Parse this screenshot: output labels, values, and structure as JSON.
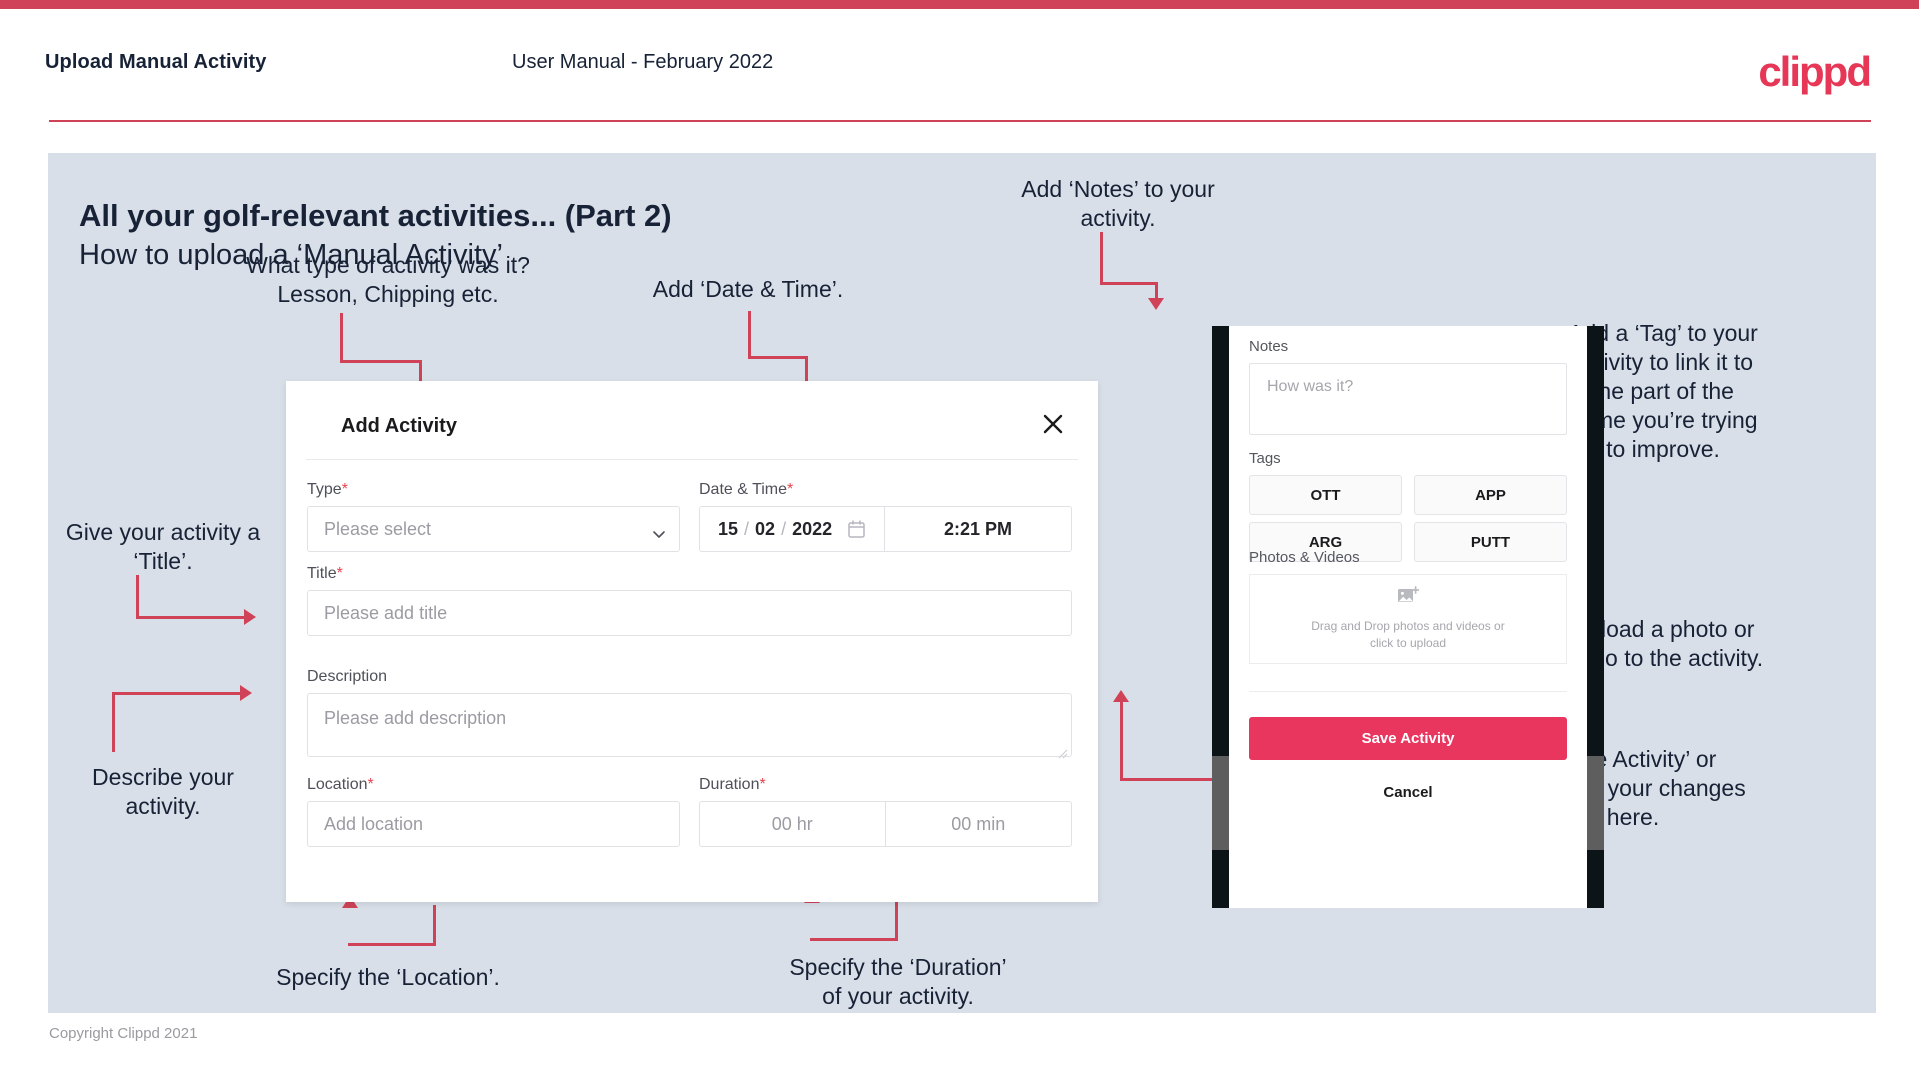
{
  "header": {
    "title": "Upload Manual Activity",
    "subtitle": "User Manual - February 2022",
    "logo": "clippd"
  },
  "slide": {
    "title": "All your golf-relevant activities... (Part 2)",
    "subtitle": "How to upload a ‘Manual Activity’"
  },
  "annotations": {
    "type": "What type of activity was it?\nLesson, Chipping etc.",
    "datetime": "Add ‘Date & Time’.",
    "title": "Give your activity a\n‘Title’.",
    "description": "Describe your\nactivity.",
    "location": "Specify the ‘Location’.",
    "duration": "Specify the ‘Duration’\nof your activity.",
    "notes": "Add ‘Notes’ to your\nactivity.",
    "tags": "Add a ‘Tag’ to your\nactivity to link it to\nthe part of the\ngame you’re trying\nto improve.",
    "upload": "Upload a photo or\nvideo to the activity.",
    "save": "‘Save Activity’ or\n‘Cancel’ your changes\nhere."
  },
  "dialog": {
    "title": "Add Activity",
    "close_label": "✕",
    "fields": {
      "type": {
        "label": "Type",
        "required": true,
        "placeholder": "Please select"
      },
      "datetime": {
        "label": "Date & Time",
        "required": true,
        "day": "15",
        "month": "02",
        "year": "2022",
        "separator": "/",
        "time": "2:21 PM"
      },
      "title": {
        "label": "Title",
        "required": true,
        "placeholder": "Please add title"
      },
      "description": {
        "label": "Description",
        "required": false,
        "placeholder": "Please add description"
      },
      "location": {
        "label": "Location",
        "required": true,
        "placeholder": "Add location"
      },
      "duration": {
        "label": "Duration",
        "required": true,
        "hours": "00 hr",
        "minutes": "00 min"
      }
    },
    "required_mark": "*"
  },
  "phone": {
    "notes": {
      "label": "Notes",
      "placeholder": "How was it?"
    },
    "tags": {
      "label": "Tags",
      "options": [
        "OTT",
        "APP",
        "ARG",
        "PUTT"
      ]
    },
    "photos": {
      "label": "Photos & Videos",
      "dropzone_line1": "Drag and Drop photos and videos or",
      "dropzone_line2": "click to upload"
    },
    "save_label": "Save Activity",
    "cancel_label": "Cancel"
  },
  "footer": {
    "copyright": "Copyright Clippd 2021"
  },
  "colors": {
    "accent": "#cf4257",
    "brand": "#e63757",
    "save_button": "#e8365f",
    "slide_bg": "#d9dfe8",
    "text_dark": "#172236",
    "required": "#e8414f"
  }
}
